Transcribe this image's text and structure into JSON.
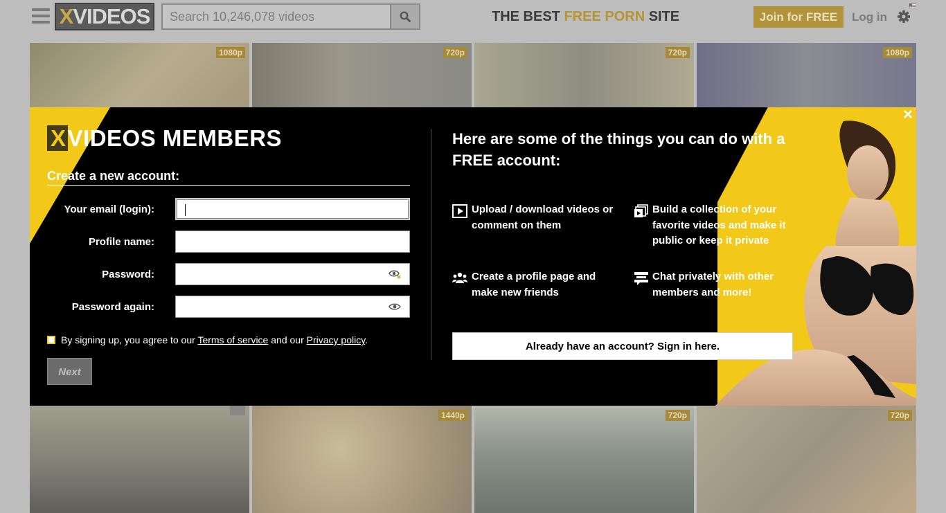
{
  "header": {
    "logo_text": "VIDEOS",
    "logo_x": "X",
    "search_placeholder": "Search 10,246,078 videos",
    "tagline_pre": "THE BEST ",
    "tagline_hl": "FREE PORN",
    "tagline_post": " SITE",
    "join_label": "Join for FREE",
    "login_label": "Log in"
  },
  "thumbnails": {
    "top": [
      {
        "res": "1080p",
        "color": "#a9a083"
      },
      {
        "res": "720p",
        "color": "#8d8a7e"
      },
      {
        "res": "720p",
        "color": "#9a9889"
      },
      {
        "res": "1080p",
        "color": "#86868f"
      }
    ],
    "bottom": [
      {
        "res": "",
        "color": "#8f8d80"
      },
      {
        "res": "1440p",
        "color": "#ab9f86"
      },
      {
        "res": "720p",
        "color": "#8a9188"
      },
      {
        "res": "720p",
        "color": "#a39d89"
      }
    ]
  },
  "modal": {
    "title_x": "X",
    "title_rest": "VIDEOS MEMBERS",
    "subtitle": "Create a new account:",
    "labels": {
      "email": "Your email (login):",
      "profile": "Profile name:",
      "password": "Password:",
      "password_again": "Password again:"
    },
    "values": {
      "email": "",
      "profile": "",
      "password": "",
      "password_again": ""
    },
    "terms_pre": "By signing up, you agree to our ",
    "terms_link": "Terms of service",
    "terms_mid": " and our ",
    "privacy_link": "Privacy policy",
    "terms_post": ".",
    "next_label": "Next",
    "right_heading": "Here are some of the things you can do with a FREE account:",
    "features": [
      {
        "icon": "play-icon",
        "text": "Upload / download videos or comment on them"
      },
      {
        "icon": "collection-icon",
        "text": "Build a collection of your favorite videos and make it public or keep it private"
      },
      {
        "icon": "friends-icon",
        "text": "Create a profile page and make new friends"
      },
      {
        "icon": "chat-icon",
        "text": "Chat privately with other members and more!"
      }
    ],
    "signin_label": "Already have an account? Sign in here.",
    "close_label": "×"
  },
  "colors": {
    "accent_yellow": "#f2c819",
    "modal_bg": "#000000",
    "overlay_gray": "#bdbdbd"
  }
}
